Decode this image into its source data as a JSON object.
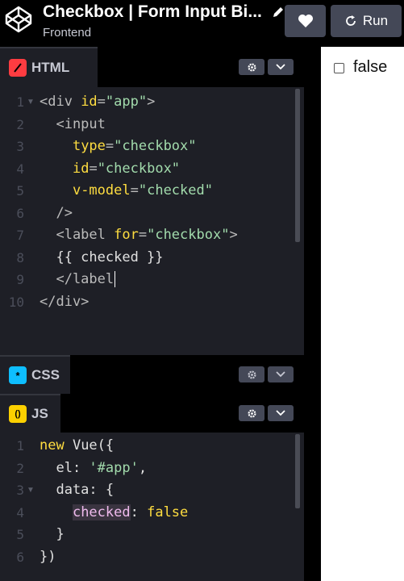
{
  "header": {
    "title": "Checkbox | Form Input Bi...",
    "subtitle": "Frontend",
    "run_label": "Run"
  },
  "html_panel": {
    "tab_label": "HTML",
    "badge_color": "#ff3c41",
    "lines": [
      {
        "n": "1",
        "fold": true,
        "parts": [
          [
            "tag",
            "<div "
          ],
          [
            "attr",
            "id"
          ],
          [
            "tag",
            "="
          ],
          [
            "str",
            "\"app\""
          ],
          [
            "tag",
            ">"
          ]
        ]
      },
      {
        "n": "2",
        "fold": false,
        "parts": [
          [
            "tag",
            "  <input"
          ]
        ]
      },
      {
        "n": "3",
        "fold": false,
        "parts": [
          [
            "tag",
            "    "
          ],
          [
            "attr",
            "type"
          ],
          [
            "tag",
            "="
          ],
          [
            "str",
            "\"checkbox\""
          ]
        ]
      },
      {
        "n": "4",
        "fold": false,
        "parts": [
          [
            "tag",
            "    "
          ],
          [
            "attr",
            "id"
          ],
          [
            "tag",
            "="
          ],
          [
            "str",
            "\"checkbox\""
          ]
        ]
      },
      {
        "n": "5",
        "fold": false,
        "parts": [
          [
            "tag",
            "    "
          ],
          [
            "attr",
            "v-model"
          ],
          [
            "tag",
            "="
          ],
          [
            "str",
            "\"checked\""
          ]
        ]
      },
      {
        "n": "6",
        "fold": false,
        "parts": [
          [
            "tag",
            "  />"
          ]
        ]
      },
      {
        "n": "7",
        "fold": false,
        "parts": [
          [
            "tag",
            "  <label "
          ],
          [
            "attr",
            "for"
          ],
          [
            "tag",
            "="
          ],
          [
            "str",
            "\"checkbox\""
          ],
          [
            "tag",
            ">"
          ]
        ]
      },
      {
        "n": "8",
        "fold": false,
        "parts": [
          [
            "plain",
            "  {{ checked }}"
          ]
        ]
      },
      {
        "n": "9",
        "fold": false,
        "parts": [
          [
            "tag",
            "  </label"
          ]
        ]
      },
      {
        "n": "10",
        "fold": false,
        "parts": [
          [
            "tag",
            "</div>"
          ]
        ]
      }
    ]
  },
  "css_panel": {
    "tab_label": "CSS",
    "badge_color": "#0ebeff",
    "badge_glyph": "*"
  },
  "js_panel": {
    "tab_label": "JS",
    "badge_color": "#fcd000",
    "badge_glyph": "()",
    "lines": [
      {
        "n": "1",
        "fold": false,
        "parts": [
          [
            "kw",
            "new "
          ],
          [
            "plain",
            "Vue({"
          ]
        ]
      },
      {
        "n": "2",
        "fold": false,
        "parts": [
          [
            "plain",
            "  el: "
          ],
          [
            "str",
            "'#app'"
          ],
          [
            "plain",
            ","
          ]
        ]
      },
      {
        "n": "3",
        "fold": true,
        "parts": [
          [
            "plain",
            "  data: {"
          ]
        ]
      },
      {
        "n": "4",
        "fold": false,
        "parts": [
          [
            "plain",
            "    "
          ],
          [
            "hl",
            "checked"
          ],
          [
            "plain",
            ": "
          ],
          [
            "kw",
            "false"
          ]
        ]
      },
      {
        "n": "5",
        "fold": false,
        "parts": [
          [
            "plain",
            "  }"
          ]
        ]
      },
      {
        "n": "6",
        "fold": false,
        "parts": [
          [
            "plain",
            "})"
          ]
        ]
      }
    ]
  },
  "preview": {
    "checkbox_checked": false,
    "label": "false"
  }
}
